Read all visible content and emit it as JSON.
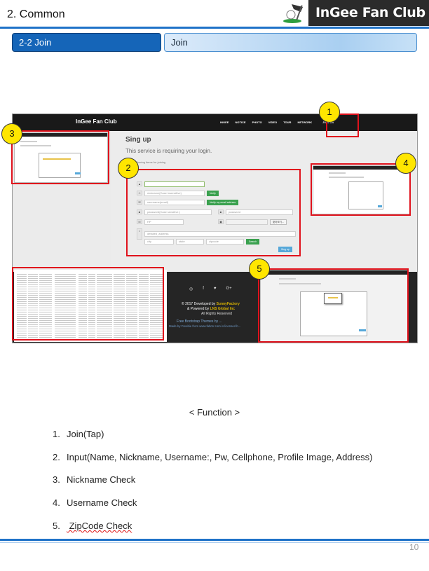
{
  "header": {
    "section_title": "2. Common",
    "brand_name": "InGee Fan Club"
  },
  "tabs": {
    "left_label": "2-2  Join",
    "right_label": "Join"
  },
  "screenshot": {
    "nav_brand": "InGee Fan Club",
    "nav_links": [
      "INGEE",
      "NOTICE",
      "PHOTO",
      "VIDEO",
      "TOUR",
      "NETWORK",
      "JOIN US"
    ],
    "signup_title": "Sing up",
    "signup_subtitle": "This service is requiring your login.",
    "signup_hint": "ter the following items for joining",
    "form": {
      "nickname_placeholder": "nickname(Case insensitive)",
      "verify_label": "Verify",
      "username_placeholder": "username(email)",
      "verify_email_label": "Verify my email address",
      "password_confirm_placeholder": "password(Case sensitive.)",
      "password_placeholder": "password",
      "zip_placeholder": "HP",
      "file_button_label": "찾아보기...",
      "address_placeholder": "detailed_address",
      "city_placeholder": "city",
      "state_placeholder": "state",
      "zipcode_placeholder": "zipcode",
      "search_label": "Search",
      "submit_label": "Sing up"
    },
    "footer": {
      "social_icons": [
        "instagram-icon",
        "facebook-icon",
        "twitter-icon",
        "google-plus-icon"
      ],
      "social_glyphs": [
        "◎",
        "f",
        "♥",
        "G+"
      ],
      "developed_prefix": "© 2017 Developed by ",
      "developed_by": "SunnyFactory",
      "powered_prefix": "& Powered by ",
      "powered_by": "LNS Global Inc",
      "rights": "All Rights Reserved",
      "credit_line": "Free Bootstrap Themes by ...",
      "extra_line": "Made by Freebie from www.fabrnr.com is licensed b..."
    }
  },
  "markers": [
    "1",
    "2",
    "3",
    "4",
    "5"
  ],
  "function": {
    "title": "< Function >",
    "items": [
      {
        "num": "1.",
        "text": "Join(Tap)"
      },
      {
        "num": "2.",
        "text": "Input(Name, Nickname, Username:, Pw, Cellphone, Profile Image, Address)"
      },
      {
        "num": "3.",
        "text": "Nickname Check"
      },
      {
        "num": "4.",
        "text": "Username Check"
      },
      {
        "num": "5.",
        "text": " ZipCode Check"
      }
    ]
  },
  "page_number": "10",
  "colors": {
    "accent_blue": "#1f72c8",
    "tab_dark": "#1565b8",
    "highlight_red": "#e0121c",
    "marker_yellow": "#ffe600"
  }
}
